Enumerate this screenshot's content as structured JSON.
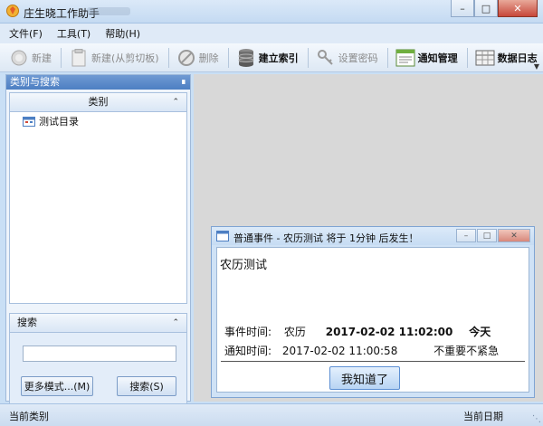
{
  "window": {
    "title": "庄生晓工作助手"
  },
  "menu": [
    "文件(F)",
    "工具(T)",
    "帮助(H)"
  ],
  "toolbar": {
    "new_label": "新建",
    "new_clip_label": "新建(从剪切板)",
    "delete_label": "删除",
    "index_label": "建立索引",
    "password_label": "设置密码",
    "notify_label": "通知管理",
    "log_label": "数据日志"
  },
  "left_panel": {
    "header": "类别与搜索",
    "category_header": "类别",
    "tree": [
      {
        "label": "测试目录"
      }
    ],
    "search_header": "搜索",
    "search_value": "",
    "more_button": "更多模式...(M)",
    "search_button": "搜索(S)"
  },
  "dialog": {
    "title": "普通事件 - 农历测试 将于 1分钟 后发生！",
    "subject": "农历测试",
    "event_time_label": "事件时间:",
    "calendar_type": "农历",
    "event_datetime": "2017-02-02  11:02:00",
    "event_day": "今天",
    "notify_time_label": "通知时间:",
    "notify_datetime": "2017-02-02 11:00:58",
    "priority": "不重要不紧急",
    "ok_button": "我知道了"
  },
  "status": {
    "left": "当前类别",
    "right": "当前日期"
  }
}
